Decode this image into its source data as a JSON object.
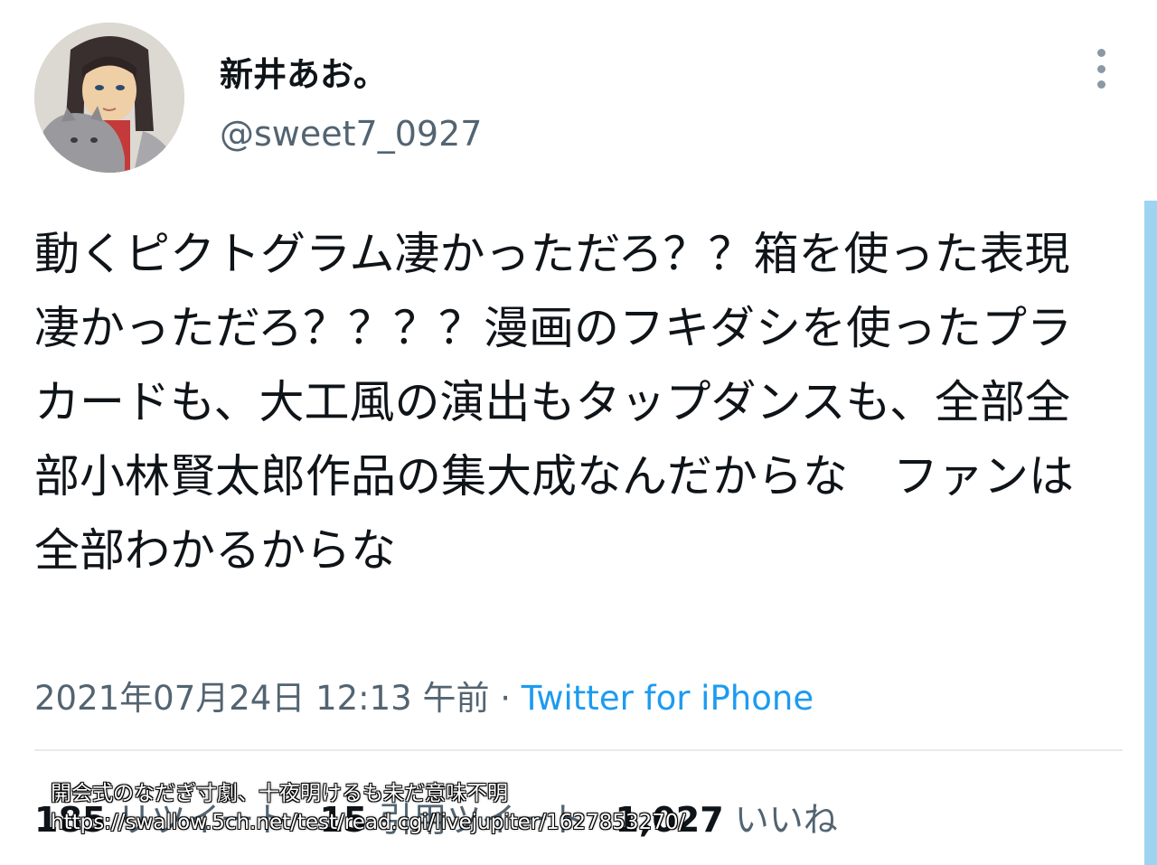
{
  "user": {
    "display_name": "新井あお。",
    "handle": "@sweet7_0927",
    "avatar_icon": "user-avatar-illustration"
  },
  "menu": {
    "icon": "more-vertical-icon"
  },
  "tweet": {
    "text": "動くピクトグラム凄かっただろ？？箱を使った表現凄かっただろ？？？？漫画のフキダシを使ったプラカードも、大工風の演出もタップダンスも、全部全部小林賢太郎作品の集大成なんだからな　ファンは全部わかるからな",
    "timestamp": "2021年07月24日 12:13 午前",
    "separator": "·",
    "source": "Twitter for iPhone"
  },
  "stats": {
    "retweets": "185",
    "retweets_label": "リツイート",
    "quotes": "15",
    "quotes_label": "引用ツイート",
    "likes": "1,027",
    "likes_label": "いいね"
  },
  "overlay": {
    "caption": "開会式のなだぎ寸劇、十夜明けるも未だ意味不明",
    "url": "https://swallow.5ch.net/test/read.cgi/livejupiter/1627853270/"
  },
  "colors": {
    "text": "#0f1419",
    "secondary": "#536471",
    "link": "#1d9bf0",
    "divider": "#e7e9ea",
    "scrollbar": "#9fd3f2"
  }
}
